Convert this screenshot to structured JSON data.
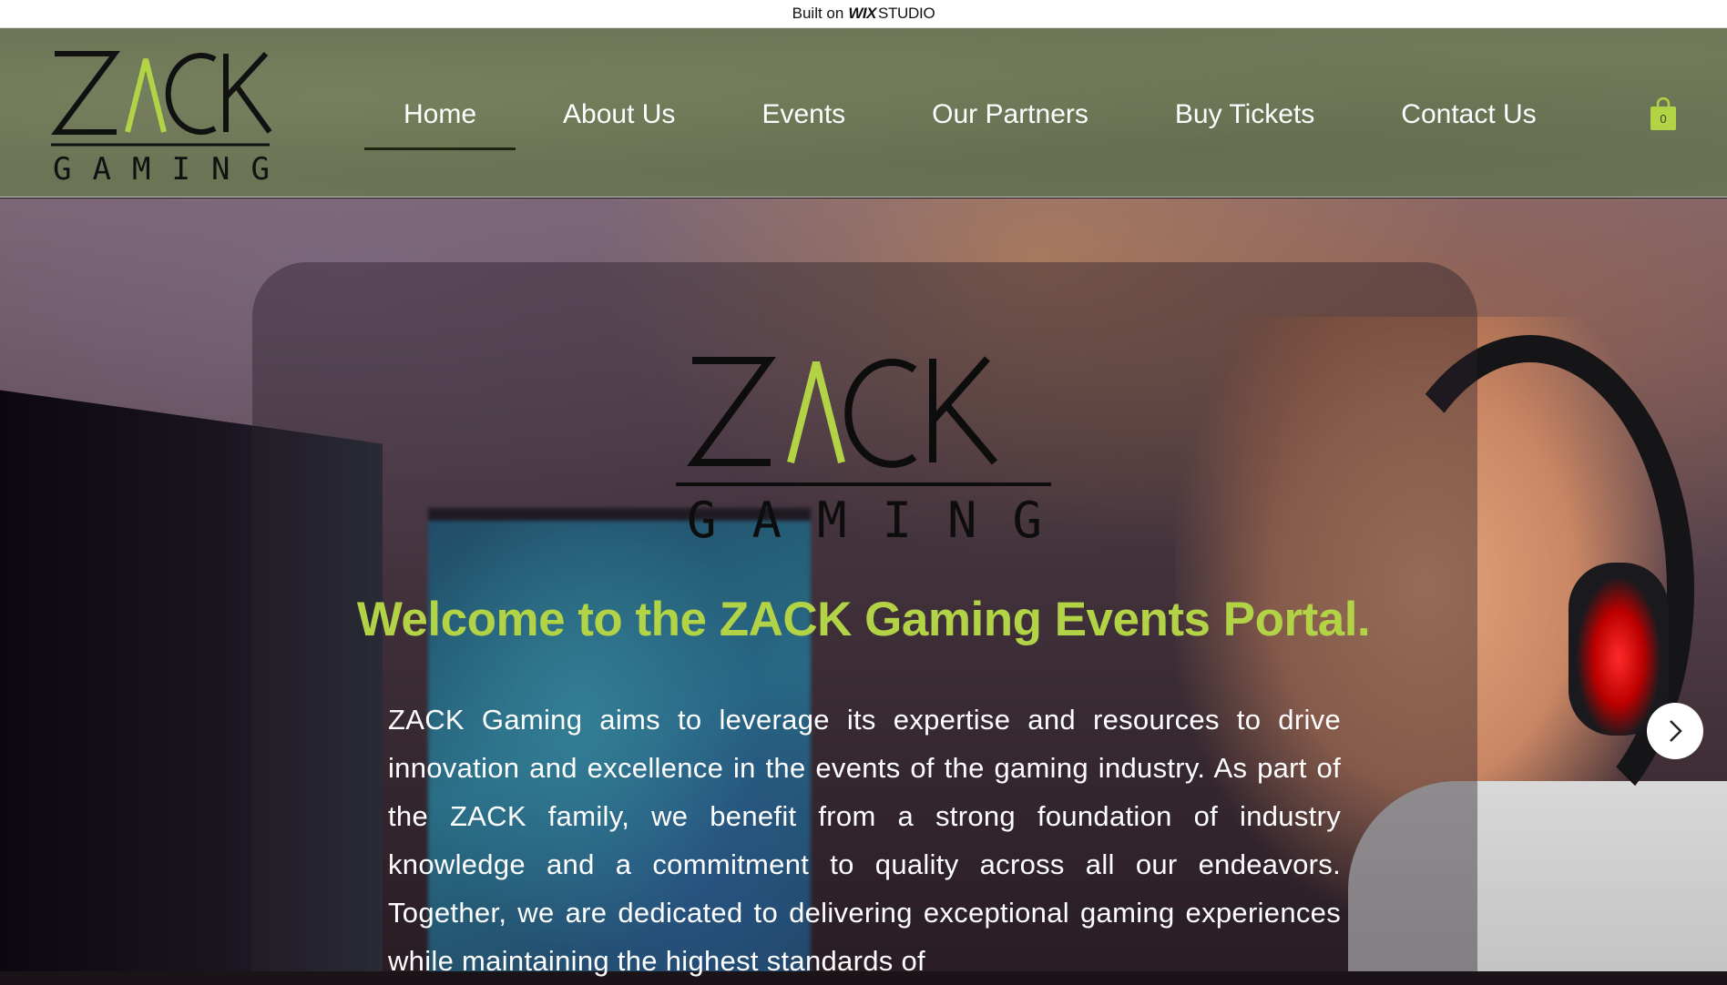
{
  "wix_banner": {
    "prefix": "Built on",
    "brand": "WIX",
    "suffix": "STUDIO"
  },
  "header": {
    "logo": {
      "word": "ZACK",
      "subword": "GAMING",
      "accent_color": "#b3d347"
    },
    "nav": [
      {
        "label": "Home",
        "active": true
      },
      {
        "label": "About Us",
        "active": false
      },
      {
        "label": "Events",
        "active": false
      },
      {
        "label": "Our Partners",
        "active": false
      },
      {
        "label": "Buy Tickets",
        "active": false
      },
      {
        "label": "Contact Us",
        "active": false
      }
    ],
    "cart": {
      "icon": "shopping-bag-icon",
      "count": "0",
      "color": "#b3d347"
    }
  },
  "hero": {
    "logo": {
      "word": "ZACK",
      "subword": "GAMING"
    },
    "headline": "Welcome to the ZACK Gaming Events Portal.",
    "intro": "ZACK Gaming aims to leverage its expertise and resources to drive innovation and excellence in the events of the gaming industry. As part of the ZACK family, we benefit from a strong foundation of industry knowledge and a commitment to quality across all our endeavors. Together, we are dedicated to delivering exceptional gaming experiences while maintaining the highest standards of",
    "headline_color": "#b3d347",
    "next_button_icon": "chevron-right-icon"
  }
}
